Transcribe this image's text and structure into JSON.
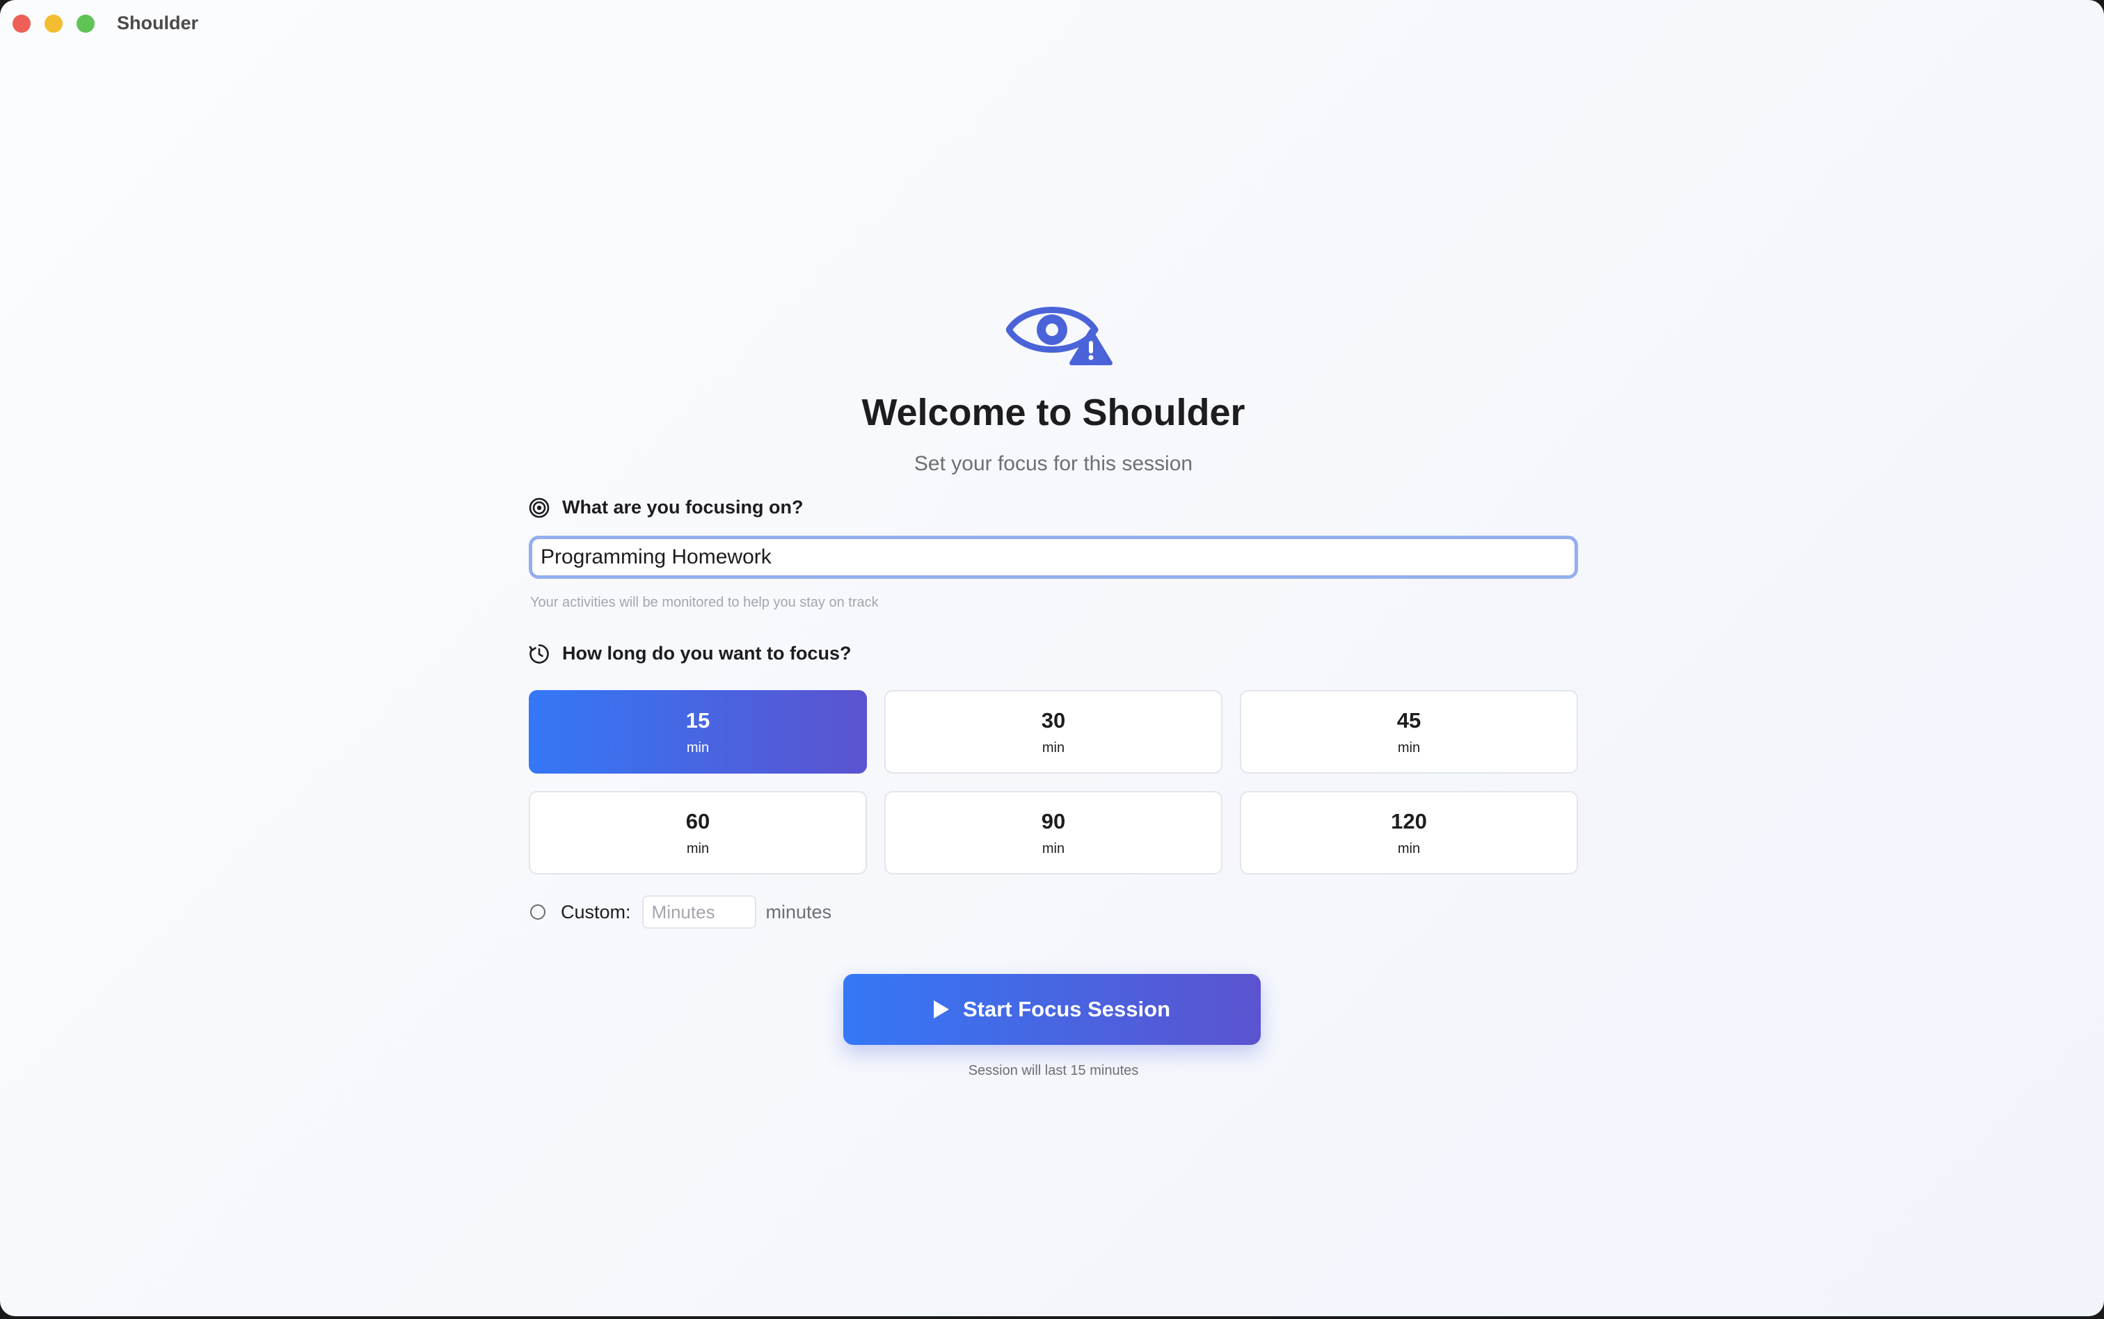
{
  "window": {
    "app_title": "Shoulder"
  },
  "header": {
    "logo_icon": "eye-warning-icon",
    "title": "Welcome to Shoulder",
    "subtitle": "Set your focus for this session"
  },
  "focus": {
    "label": "What are you focusing on?",
    "icon": "target-icon",
    "value": "Programming Homework",
    "hint": "Your activities will be monitored to help you stay on track"
  },
  "duration": {
    "label": "How long do you want to focus?",
    "icon": "timer-icon",
    "options": [
      {
        "value": "15",
        "unit": "min",
        "selected": true
      },
      {
        "value": "30",
        "unit": "min",
        "selected": false
      },
      {
        "value": "45",
        "unit": "min",
        "selected": false
      },
      {
        "value": "60",
        "unit": "min",
        "selected": false
      },
      {
        "value": "90",
        "unit": "min",
        "selected": false
      },
      {
        "value": "120",
        "unit": "min",
        "selected": false
      }
    ],
    "custom_label": "Custom:",
    "custom_placeholder": "Minutes",
    "custom_value": "",
    "custom_unit": "minutes"
  },
  "start": {
    "label": "Start Focus Session",
    "icon": "play-icon",
    "note": "Session will last 15 minutes"
  },
  "colors": {
    "accent_start": "#3478f6",
    "accent_end": "#5b53cf",
    "logo": "#4a63d9",
    "input_focus_border": "#94aeee"
  }
}
